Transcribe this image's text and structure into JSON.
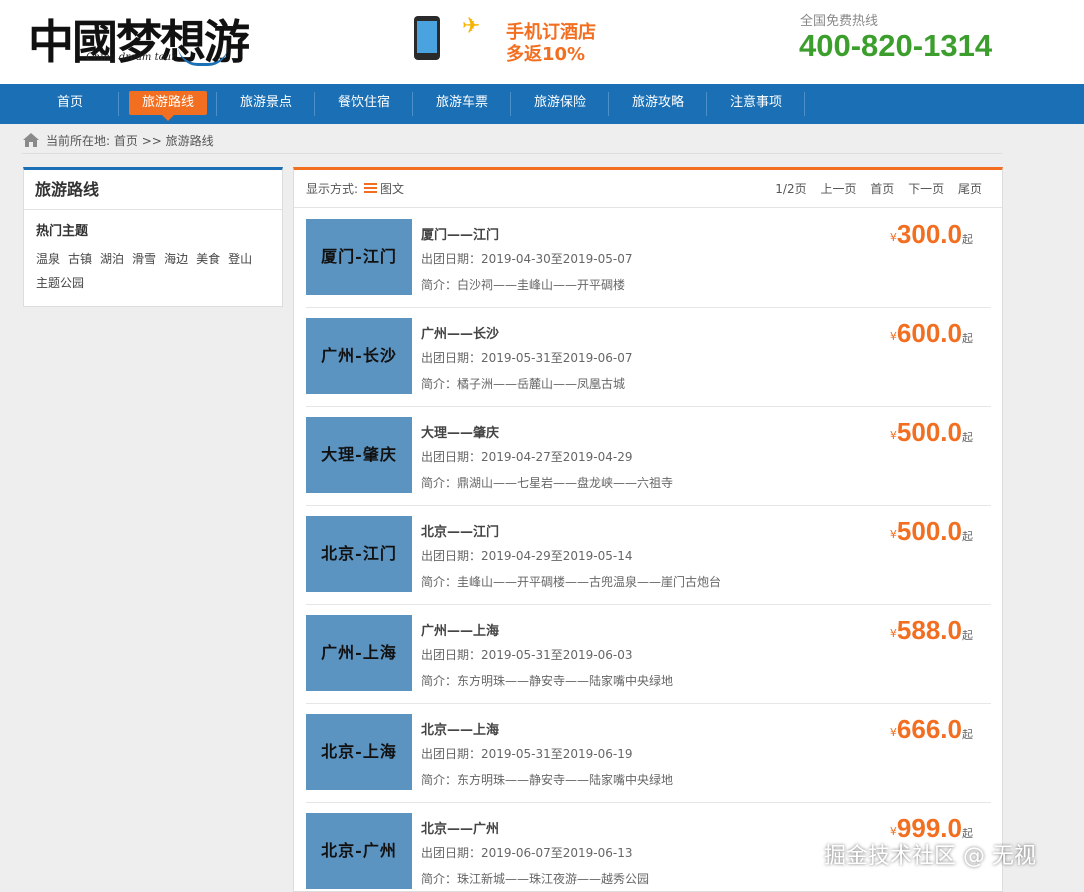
{
  "header": {
    "logo_text": "中國梦想游",
    "logo_subtitle": "China dream tour",
    "promo_line1": "手机订酒店",
    "promo_line2": "多返10%",
    "hotline_label": "全国免费热线",
    "hotline_number": "400-820-1314"
  },
  "nav": {
    "items": [
      {
        "label": "首页",
        "active": false
      },
      {
        "label": "旅游路线",
        "active": true
      },
      {
        "label": "旅游景点",
        "active": false
      },
      {
        "label": "餐饮住宿",
        "active": false
      },
      {
        "label": "旅游车票",
        "active": false
      },
      {
        "label": "旅游保险",
        "active": false
      },
      {
        "label": "旅游攻略",
        "active": false
      },
      {
        "label": "注意事项",
        "active": false
      }
    ]
  },
  "breadcrumb": {
    "prefix": "当前所在地:",
    "home": "首页",
    "separator": ">>",
    "current": "旅游路线"
  },
  "sidebar": {
    "title": "旅游路线",
    "subtitle": "热门主题",
    "tags": [
      "温泉",
      "古镇",
      "湖泊",
      "滑雪",
      "海边",
      "美食",
      "登山",
      "主题公园"
    ]
  },
  "toolbar": {
    "display_label": "显示方式:",
    "view_mode": "图文",
    "page_info": "1/2页",
    "prev": "上一页",
    "first": "首页",
    "next": "下一页",
    "last": "尾页"
  },
  "price_prefix": "¥",
  "price_suffix": "起",
  "routes": [
    {
      "thumb": "厦门-江门",
      "title": "厦门——江门",
      "dates": "出团日期：2019-04-30至2019-05-07",
      "intro": "简介：白沙祠——圭峰山——开平碉楼",
      "price": "300.0"
    },
    {
      "thumb": "广州-长沙",
      "title": "广州——长沙",
      "dates": "出团日期：2019-05-31至2019-06-07",
      "intro": "简介：橘子洲——岳麓山——凤凰古城",
      "price": "600.0"
    },
    {
      "thumb": "大理-肇庆",
      "title": "大理——肇庆",
      "dates": "出团日期：2019-04-27至2019-04-29",
      "intro": "简介：鼎湖山——七星岩——盘龙峡——六祖寺",
      "price": "500.0"
    },
    {
      "thumb": "北京-江门",
      "title": "北京——江门",
      "dates": "出团日期：2019-04-29至2019-05-14",
      "intro": "简介：圭峰山——开平碉楼——古兜温泉——崖门古炮台",
      "price": "500.0"
    },
    {
      "thumb": "广州-上海",
      "title": "广州——上海",
      "dates": "出团日期：2019-05-31至2019-06-03",
      "intro": "简介：东方明珠——静安寺——陆家嘴中央绿地",
      "price": "588.0"
    },
    {
      "thumb": "北京-上海",
      "title": "北京——上海",
      "dates": "出团日期：2019-05-31至2019-06-19",
      "intro": "简介：东方明珠——静安寺——陆家嘴中央绿地",
      "price": "666.0"
    },
    {
      "thumb": "北京-广州",
      "title": "北京——广州",
      "dates": "出团日期：2019-06-07至2019-06-13",
      "intro": "简介：珠江新城——珠江夜游——越秀公园",
      "price": "999.0"
    }
  ],
  "watermark": "掘金技术社区 @ 无视"
}
